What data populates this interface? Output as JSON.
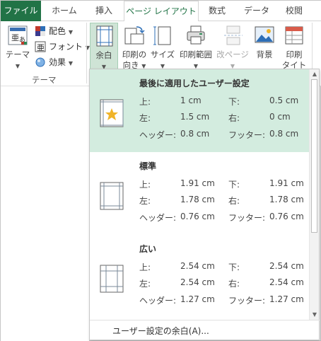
{
  "tabs": [
    {
      "label": "ファイル"
    },
    {
      "label": "ホーム"
    },
    {
      "label": "挿入"
    },
    {
      "label": "ページ レイアウト"
    },
    {
      "label": "数式"
    },
    {
      "label": "データ"
    },
    {
      "label": "校閲"
    }
  ],
  "ribbon": {
    "theme_button": "テーマ",
    "colors": "配色",
    "fonts": "フォント",
    "effects": "効果",
    "group_theme": "テーマ",
    "margins": "余白",
    "orientation_1": "印刷の",
    "orientation_2": "向き",
    "size": "サイズ",
    "print_area": "印刷範囲",
    "breaks": "改ページ",
    "background": "背景",
    "print_titles_1": "印刷",
    "print_titles_2": "タイトル",
    "accent": "#217346"
  },
  "margins_menu": {
    "items": [
      {
        "title": "最後に適用したユーザー設定",
        "top_label": "上:",
        "top": "1 cm",
        "bottom_label": "下:",
        "bottom": "0.5 cm",
        "left_label": "左:",
        "left": "1.5 cm",
        "right_label": "右:",
        "right": "0 cm",
        "header_label": "ヘッダー:",
        "header": "0.8 cm",
        "footer_label": "フッター:",
        "footer": "0.8 cm"
      },
      {
        "title": "標準",
        "top_label": "上:",
        "top": "1.91 cm",
        "bottom_label": "下:",
        "bottom": "1.91 cm",
        "left_label": "左:",
        "left": "1.78 cm",
        "right_label": "右:",
        "right": "1.78 cm",
        "header_label": "ヘッダー:",
        "header": "0.76 cm",
        "footer_label": "フッター:",
        "footer": "0.76 cm"
      },
      {
        "title": "広い",
        "top_label": "上:",
        "top": "2.54 cm",
        "bottom_label": "下:",
        "bottom": "2.54 cm",
        "left_label": "左:",
        "left": "2.54 cm",
        "right_label": "右:",
        "right": "2.54 cm",
        "header_label": "ヘッダー:",
        "header": "1.27 cm",
        "footer_label": "フッター:",
        "footer": "1.27 cm"
      }
    ],
    "custom_label": "ユーザー設定の余白(A)...",
    "highlight_color": "#d3ecdf"
  }
}
